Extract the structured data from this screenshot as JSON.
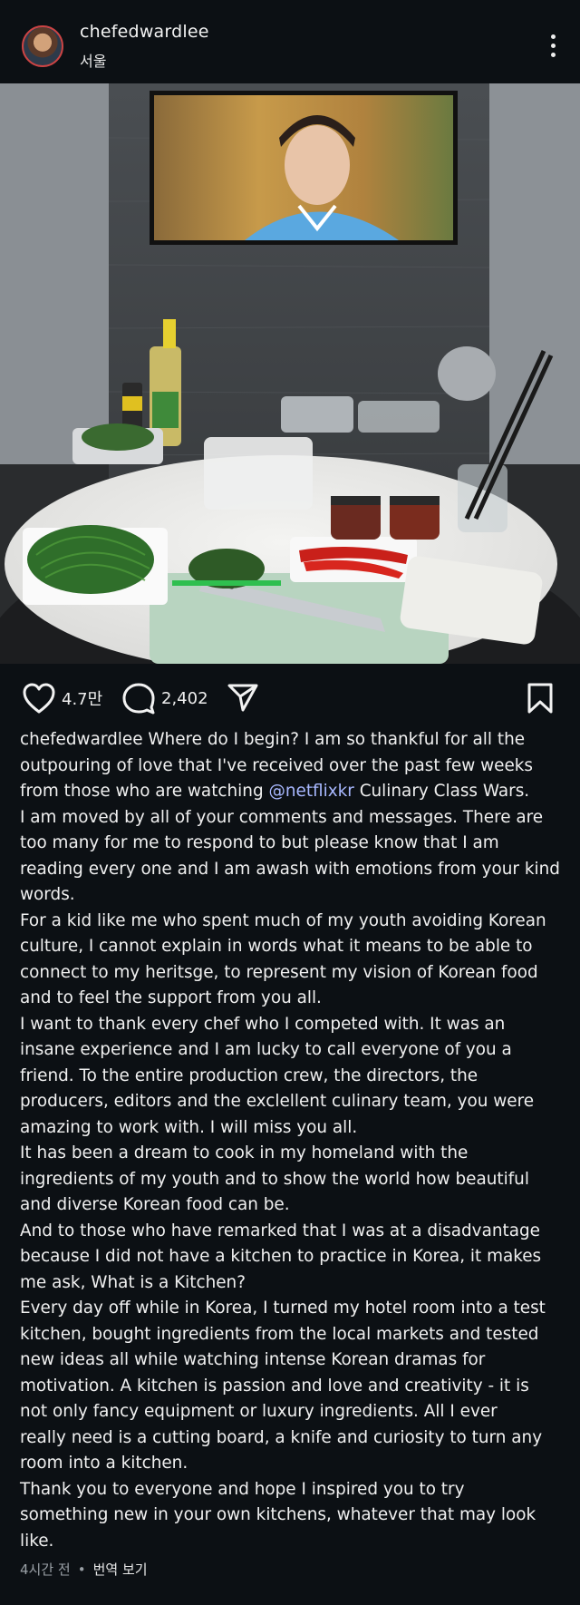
{
  "post": {
    "username": "chefedwardlee",
    "location": "서울",
    "likes": "4.7만",
    "comments": "2,402",
    "caption_lines": [
      "chefedwardlee Where do I begin?  I am so thankful for all the",
      "outpouring of love that I've received over the past few weeks",
      "from those who are watching ",
      "@netflixkr",
      " Culinary Class Wars.",
      "I am moved by all of your comments and messages.  There are",
      "too many for me to respond to but please know that I am",
      "reading every one and I am awash with emotions from your kind",
      "words.",
      "For a kid like me who spent much of my youth avoiding Korean",
      "culture, I cannot explain in words what it means to  be able to",
      "connect to my heritsge, to represent my vision of Korean food",
      "and to feel the support from you all.",
      "I want to thank every chef who I competed with.  It was an",
      "insane experience and I am lucky to call everyone of you a",
      "friend.  To the entire production crew, the directors, the",
      "producers, editors and the exclellent culinary team, you were",
      "amazing to work with.  I will miss you all.",
      "It has been a dream to cook in my homeland with the",
      "ingredients of my youth and to show the world how beautiful",
      "and diverse Korean food can be.",
      "And to those who have remarked that I was at a disadvantage",
      "because I did not have a kitchen to practice in Korea, it makes",
      "me ask, What is a Kitchen?",
      "Every day off while in Korea, I turned my hotel room into a test",
      "kitchen, bought ingredients from the local markets and tested",
      "new ideas all while watching intense Korean dramas for",
      "motivation.  A kitchen is passion and love and creativity - it is",
      "not only fancy equipment or luxury ingredients.  All I ever",
      "really need is a cutting board, a knife and curiosity to turn any",
      "room into a kitchen.",
      "Thank you to everyone and hope I inspired you to try",
      "something new in your own kitchens, whatever that may look",
      "like."
    ],
    "time_ago": "4시간 전",
    "translate_label": "번역 보기"
  }
}
